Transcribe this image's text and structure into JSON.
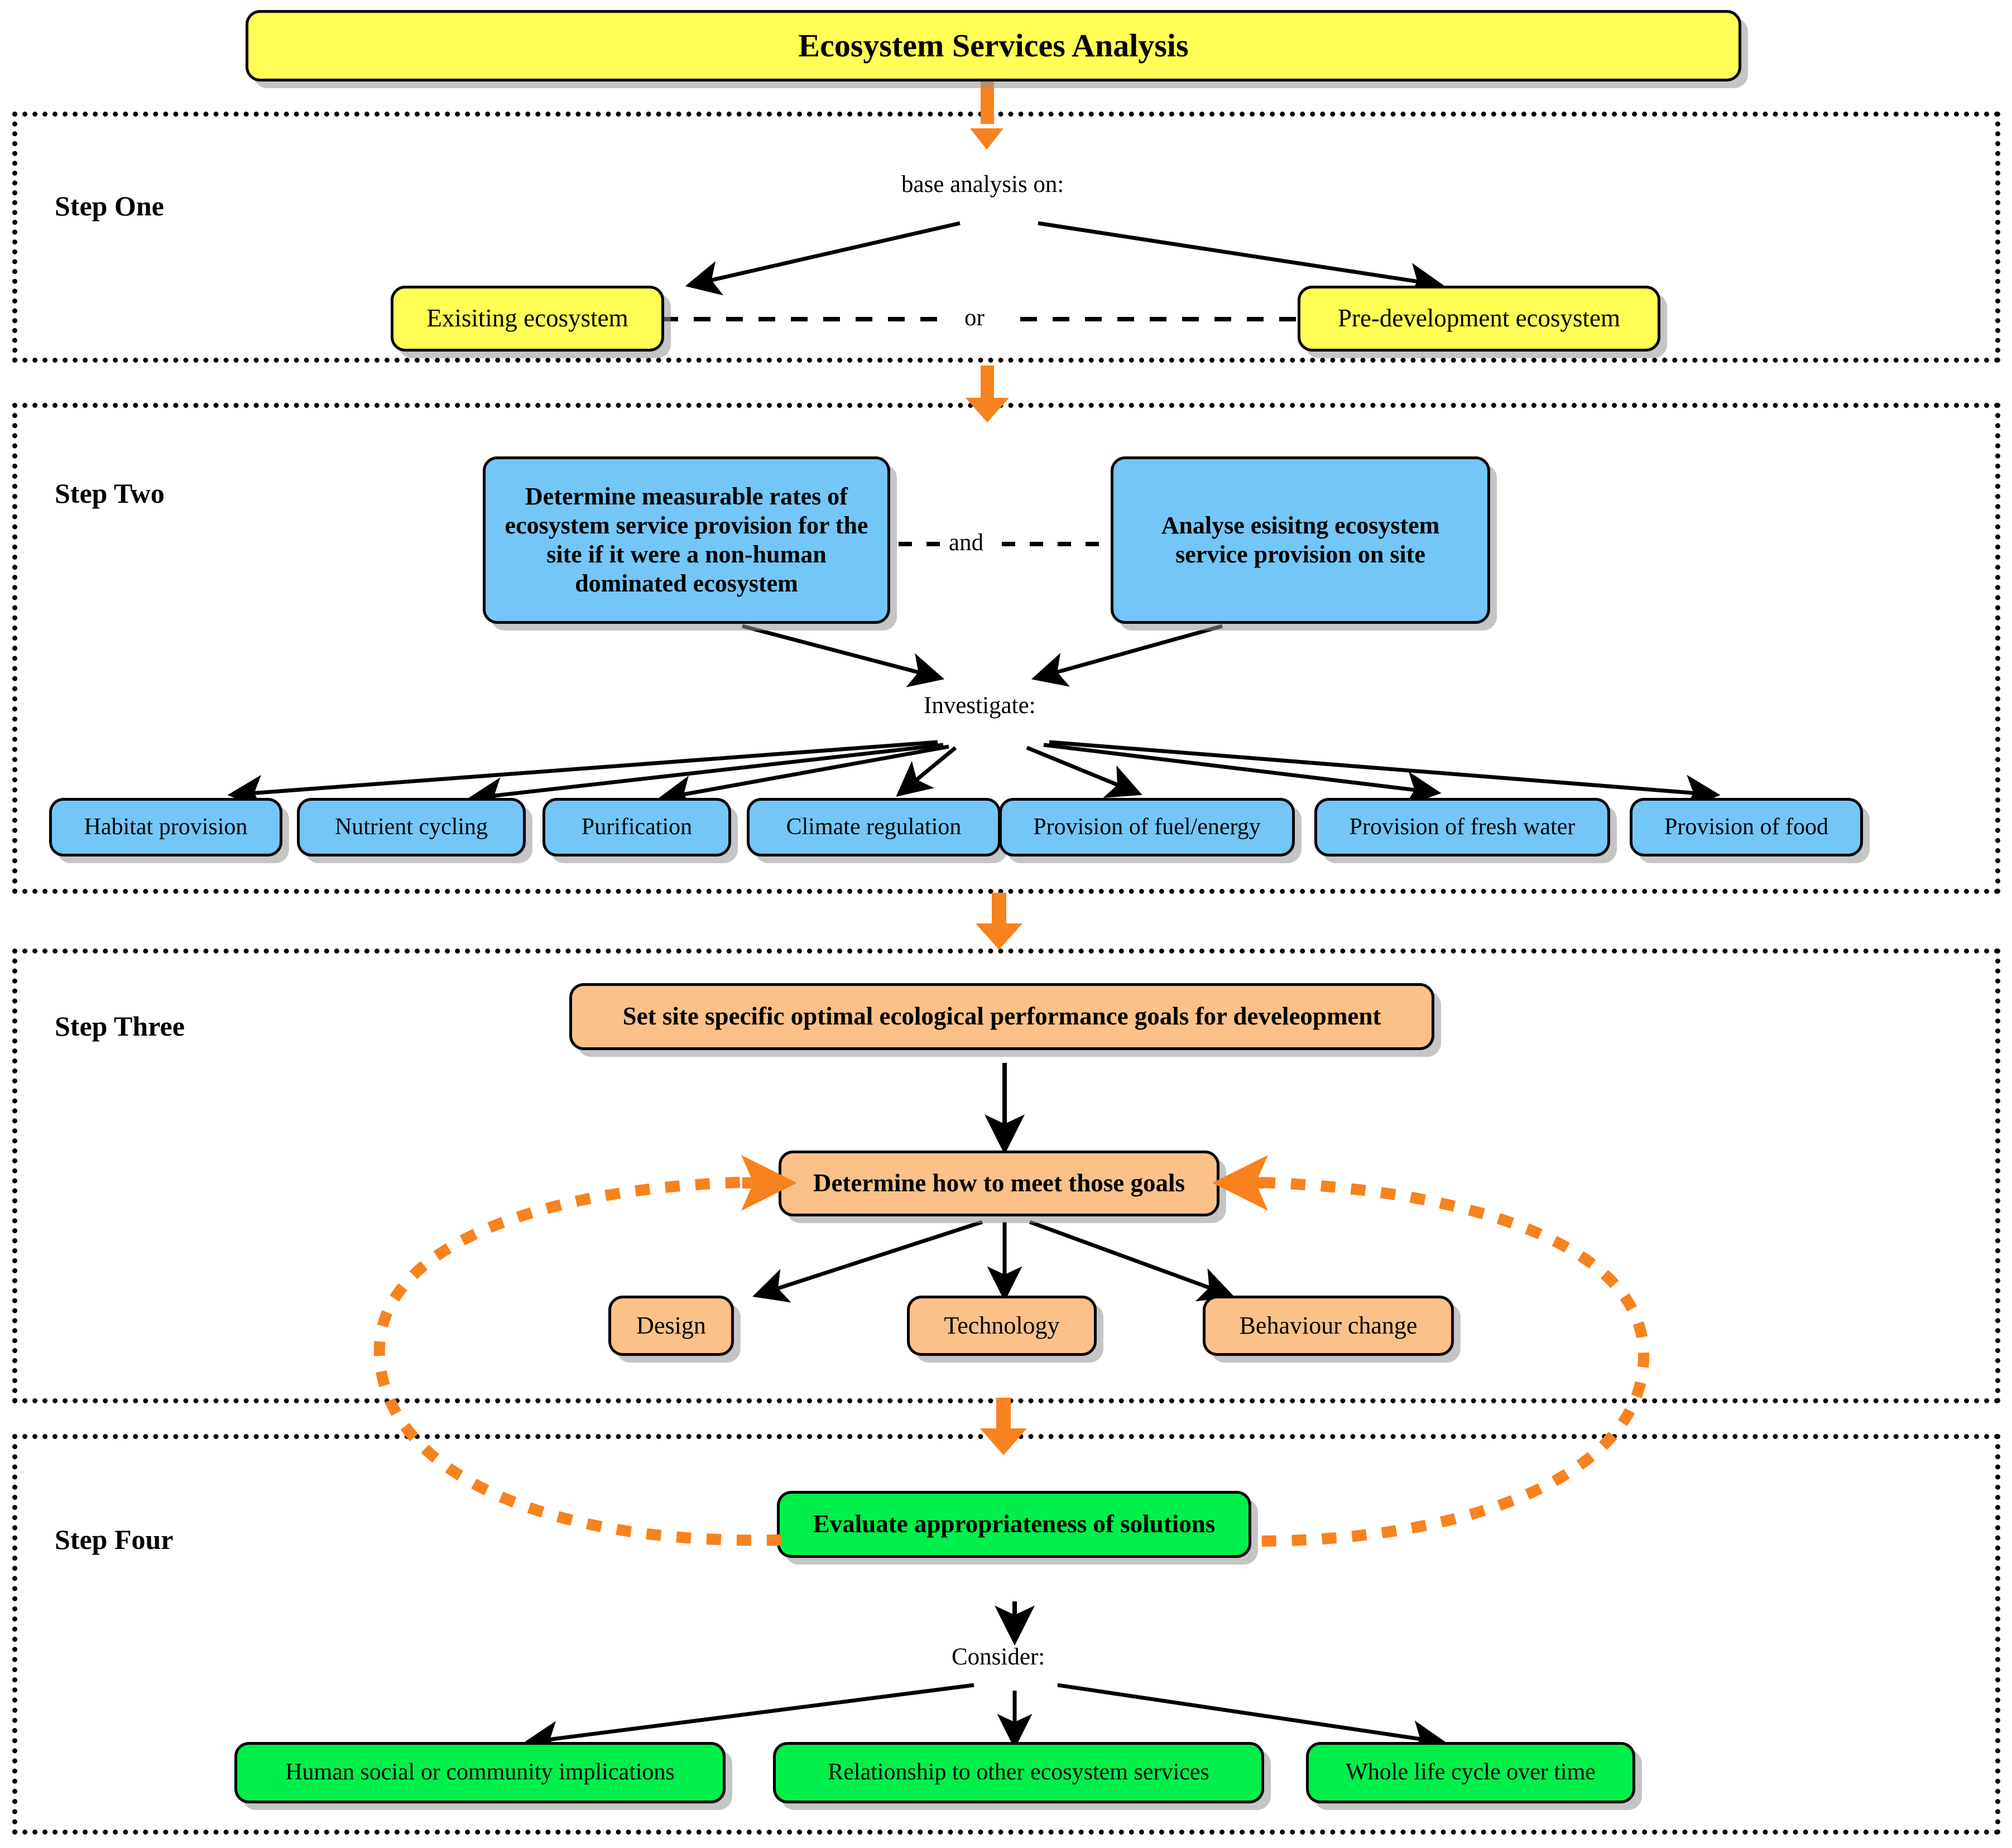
{
  "title_box": {
    "label": "Ecosystem Services Analysis"
  },
  "colors": {
    "yellow": "#FFFF55",
    "blue": "#74C6F7",
    "orange": "#FBC189",
    "green": "#00EF4A",
    "arrow_orange": "#F7821E",
    "arrow_black": "#000000",
    "panel_border": "#000000",
    "background": "#FFFFFF"
  },
  "steps": [
    {
      "label": "Step One",
      "caption": "base analysis on:",
      "connector_label": "or",
      "nodes": [
        {
          "label": "Exisiting ecosystem"
        },
        {
          "label": "Pre-development ecosystem"
        }
      ]
    },
    {
      "label": "Step Two",
      "connector_label": "and",
      "caption": "Investigate:",
      "top_nodes": [
        {
          "label": "Determine measurable rates of ecosystem service provision for the site if it were a non-human dominated ecosystem"
        },
        {
          "label": "Analyse esisitng ecosystem service provision on site"
        }
      ],
      "service_nodes": [
        {
          "label": "Habitat provision"
        },
        {
          "label": "Nutrient cycling"
        },
        {
          "label": "Purification"
        },
        {
          "label": "Climate regulation"
        },
        {
          "label": "Provision of fuel/energy"
        },
        {
          "label": "Provision of fresh water"
        },
        {
          "label": "Provision of food"
        }
      ]
    },
    {
      "label": "Step Three",
      "nodes": [
        {
          "label": "Set site specific optimal ecological performance goals for develeopment"
        },
        {
          "label": "Determine how to meet those goals"
        }
      ],
      "method_nodes": [
        {
          "label": "Design"
        },
        {
          "label": "Technology"
        },
        {
          "label": "Behaviour change"
        }
      ]
    },
    {
      "label": "Step Four",
      "caption": "Consider:",
      "nodes": [
        {
          "label": "Evaluate appropriateness of solutions"
        }
      ],
      "consider_nodes": [
        {
          "label": "Human social or community implications"
        },
        {
          "label": "Relationship to other ecosystem services"
        },
        {
          "label": "Whole life cycle over time"
        }
      ]
    }
  ]
}
